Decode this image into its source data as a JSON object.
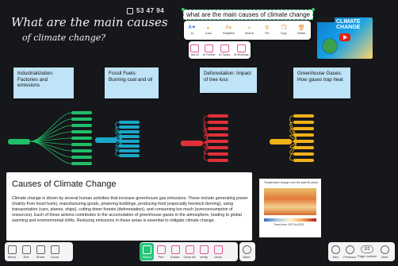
{
  "board": {
    "handwritten_title_line1": "What are the main causes",
    "handwritten_title_line2": "of climate change?",
    "session_code": "53 47 94",
    "selected_text": "what are the main causes of climate change"
  },
  "context_toolbar": {
    "items": [
      {
        "label": "AI",
        "icon": "ai-sparkle-icon"
      },
      {
        "label": "Color",
        "icon": "palette-icon"
      },
      {
        "label": "Simplified",
        "icon": "text-size-icon"
      },
      {
        "label": "Search",
        "icon": "search-icon"
      },
      {
        "label": "Pin",
        "icon": "pin-icon"
      },
      {
        "label": "Copy",
        "icon": "copy-icon"
      },
      {
        "label": "Delete",
        "icon": "trash-icon"
      }
    ]
  },
  "ai_toolbar": {
    "items": [
      {
        "label": "Ask AI",
        "icon": "ai-chat-icon"
      },
      {
        "label": "AI Further",
        "icon": "ai-expand-icon"
      },
      {
        "label": "AI Topics",
        "icon": "ai-topics-icon"
      },
      {
        "label": "AI Mindmap",
        "icon": "ai-mindmap-icon"
      }
    ]
  },
  "video": {
    "title_line1": "CLIMATE",
    "title_line2": "CHANGE"
  },
  "notes": [
    {
      "text": "Industrialization: Factories and emissions"
    },
    {
      "text": "Fossil Fuels: Burning coal and oil"
    },
    {
      "text": "Deforestation: Impact of tree loss"
    },
    {
      "text": "Greenhouse Gases: How gases trap heat"
    }
  ],
  "mindmap": {
    "colors": [
      "#1fbf6a",
      "#19a7c9",
      "#e0303a",
      "#f0b21a"
    ]
  },
  "info_panel": {
    "title": "Causes of Climate Change",
    "body": "Climate change is driven by several human activities that increase greenhouse gas emissions. These include generating power (mainly from fossil fuels), manufacturing goods, powering buildings, producing food (especially livestock farming), using transportation (cars, planes, ships), cutting down forests (deforestation), and consuming too much (overconsumption of resources). Each of these actions contributes to the accumulation of greenhouse gases in the atmosphere, leading to global warming and environmental shifts. Reducing emissions in these areas is essential to mitigate climate change."
  },
  "map_image": {
    "title": "Temperature change over the past 50 years",
    "caption": "Trend from 1970 to 2023"
  },
  "bottom_bar": {
    "left": [
      {
        "label": "Menu",
        "icon": "menu-icon"
      },
      {
        "label": "Exit",
        "icon": "exit-icon"
      },
      {
        "label": "Share",
        "icon": "share-icon"
      },
      {
        "label": "Cloud",
        "icon": "cloud-icon"
      }
    ],
    "tools": [
      {
        "label": "Select",
        "icon": "select-icon",
        "active": true
      },
      {
        "label": "Pen",
        "icon": "pen-icon"
      },
      {
        "label": "Eraser",
        "icon": "eraser-icon"
      },
      {
        "label": "Clear All",
        "icon": "clear-all-icon"
      },
      {
        "label": "Verify",
        "icon": "verify-icon"
      },
      {
        "label": "Undo",
        "icon": "undo-icon"
      }
    ],
    "more_label": "More",
    "nav": {
      "add_label": "Add",
      "previous_label": "Previous",
      "page_indicator": "2/2",
      "page_number_label": "Page number",
      "next_label": "Next"
    }
  }
}
